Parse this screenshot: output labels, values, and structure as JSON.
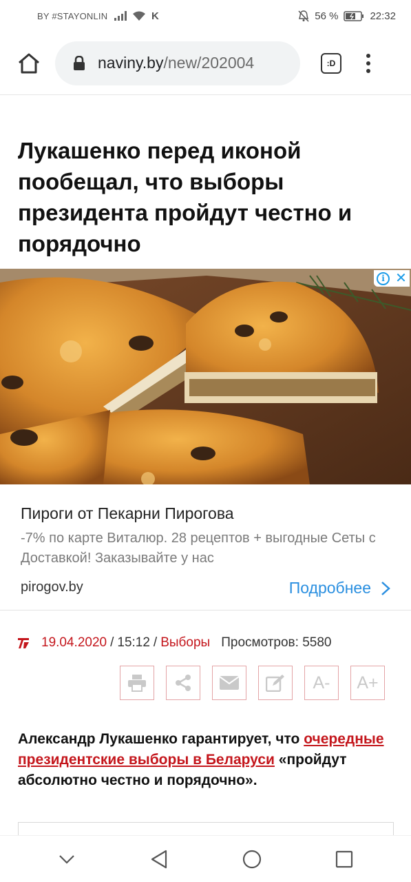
{
  "status_bar": {
    "carrier": "BY #STAYONLIN",
    "network": "K",
    "battery_percent": "56 %",
    "time": "22:32"
  },
  "browser": {
    "url_host": "naviny.by",
    "url_path": "/new/202004",
    "tab_switcher_label": ":D"
  },
  "article": {
    "headline": "Лукашенко перед иконой пообещал, что выборы президента пройдут честно и порядочно",
    "date": "19.04.2020",
    "separator": "/",
    "time": "15:12",
    "category": "Выборы",
    "views": "Просмотров: 5580",
    "lead_before": "Александр Лукашенко гарантирует, что ",
    "lead_link": "очередные президентские выборы в Беларуси",
    "lead_after": " «пройдут абсолютно честно и порядочно»."
  },
  "ad": {
    "title": "Пироги от Пекарни Пирогова",
    "description": "-7% по карте Виталюр. 28 рецептов + выгодные Сеты с Доставкой! Заказывайте у нас",
    "domain": "pirogov.by",
    "cta": "Подробнее"
  },
  "tools": [
    {
      "name": "print-icon",
      "label": ""
    },
    {
      "name": "share-icon",
      "label": ""
    },
    {
      "name": "email-icon",
      "label": ""
    },
    {
      "name": "edit-icon",
      "label": ""
    },
    {
      "name": "font-decrease",
      "label": "A-"
    },
    {
      "name": "font-increase",
      "label": "A+"
    }
  ],
  "colors": {
    "accent": "#c4161c",
    "link_blue": "#2a8fe0"
  }
}
